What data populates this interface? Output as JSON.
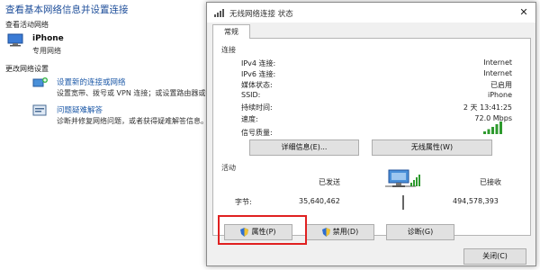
{
  "background": {
    "heading": "查看基本网络信息并设置连接",
    "active_networks_label": "查看活动网络",
    "network_name": "iPhone",
    "network_type": "专用网络",
    "change_settings_label": "更改网络设置",
    "options": [
      {
        "icon": "network-setup-icon",
        "link": "设置新的连接或网络",
        "desc": "设置宽带、拨号或 VPN 连接；或设置路由器或接入点。"
      },
      {
        "icon": "troubleshoot-icon",
        "link": "问题疑难解答",
        "desc": "诊断并修复网络问题，或者获得疑难解答信息。"
      }
    ]
  },
  "dialog": {
    "title": "无线网络连接 状态",
    "close_glyph": "✕",
    "tab": "常规",
    "connection": {
      "group_label": "连接",
      "rows": [
        {
          "label": "IPv4 连接:",
          "value": "Internet"
        },
        {
          "label": "IPv6 连接:",
          "value": "Internet"
        },
        {
          "label": "媒体状态:",
          "value": "已启用"
        },
        {
          "label": "SSID:",
          "value": "iPhone"
        },
        {
          "label": "持续时间:",
          "value": "2 天 13:41:25"
        },
        {
          "label": "速度:",
          "value": "72.0 Mbps"
        }
      ],
      "signal_label": "信号质量:",
      "signal_bars": 5,
      "details_button": "详细信息(E)...",
      "wireless_props_button": "无线属性(W)"
    },
    "activity": {
      "group_label": "活动",
      "sent_label": "已发送",
      "received_label": "已接收",
      "bytes_label": "字节:",
      "sent_bytes": "35,640,462",
      "received_bytes": "494,578,393"
    },
    "buttons": {
      "properties": "属性(P)",
      "disable": "禁用(D)",
      "diagnose": "诊断(G)",
      "close": "关闭(C)"
    },
    "colors": {
      "highlight": "#e02020",
      "link": "#1e5aa8",
      "signal": "#2e9a2e"
    }
  }
}
